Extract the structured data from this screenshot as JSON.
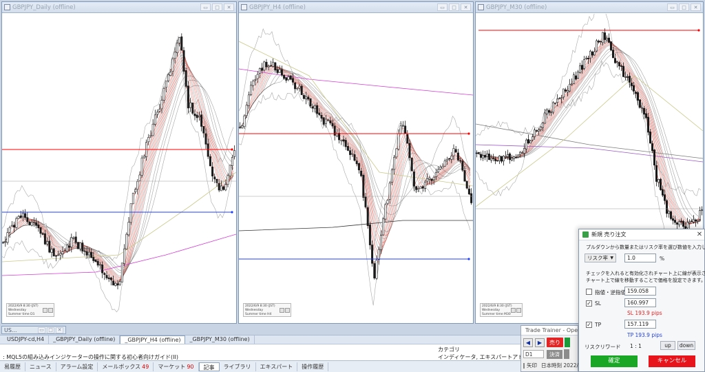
{
  "colors": {
    "candle": "#1a1a1a",
    "sl_line": "#ff0000",
    "tp_line": "#1f3fff",
    "ribbon_red": "#e8483a",
    "ribbon_gray": "#555555",
    "sell": "#e22424",
    "buy": "#1c9a3a"
  },
  "charts": [
    {
      "title": "GBPJPY_Daily (offline)",
      "info": {
        "line1": "2022/6/9 8:30 (JST)",
        "line2": "Wednesday",
        "line3": "Summer time",
        "tf": "D1"
      }
    },
    {
      "title": "GBPJPY_H4 (offline)",
      "info": {
        "line1": "2022/6/9 8:30 (JST)",
        "line2": "Wednesday",
        "line3": "Summer time",
        "tf": "H4"
      }
    },
    {
      "title": "GBPJPY_M30 (offline)",
      "info": {
        "line1": "2022/6/9 8:30 (JST)",
        "line2": "Wednesday",
        "line3": "Summer time",
        "tf": "M30"
      }
    }
  ],
  "minimized_window": {
    "title": "US..."
  },
  "chart_tabs": [
    "USDJPY-cd,H4",
    "_GBPJPY_Daily (offline)",
    "_GBPJPY_H4 (offline)",
    "_GBPJPY_M30 (offline)"
  ],
  "active_chart_tab": 2,
  "navigator": {
    "left_text": ": MQL5の組み込みインジケーターの操作に関する初心者向けガイド(II)",
    "category_header": "カテゴリ",
    "category_value": "インディケータ, エキスパートアドバイザー, インディ"
  },
  "terminal_tabs": [
    {
      "label": "易履歴"
    },
    {
      "label": "ニュース"
    },
    {
      "label": "アラーム設定"
    },
    {
      "label": "メールボックス",
      "count": "49"
    },
    {
      "label": "マーケット",
      "count": "90"
    },
    {
      "label": "記事",
      "active": true
    },
    {
      "label": "ライブラリ"
    },
    {
      "label": "エキスパート"
    },
    {
      "label": "操作履歴"
    }
  ],
  "trade_trainer": {
    "title": "Trade Trainer - Operat",
    "sell_label": "売り",
    "timeframe": "D1",
    "settle_label": "決済",
    "arrow_label": "矢印",
    "time_label": "日本時刻 2022/"
  },
  "order_dialog": {
    "title": "新規 売り注文",
    "instruction": "プルダウンから数量またはリスク率を選び数値を入力してください。",
    "mode_select": "リスク率",
    "risk_value": "1.0",
    "risk_unit": "%",
    "help_line1": "チェックを入れると有効化されチャート上に線が表示されます。",
    "help_line2": "チャート上で線を移動することで価格を設定できます。",
    "limit_label": "指値・逆指値",
    "limit_value": "159.058",
    "limit_checked": false,
    "sl_label": "SL",
    "sl_value": "160.997",
    "sl_checked": true,
    "sl_pips": "SL 193.9 pips",
    "tp_label": "TP",
    "tp_value": "157.119",
    "tp_checked": true,
    "tp_pips": "TP 193.9 pips",
    "rr_label": "リスクリワード",
    "rr_value": "1 : 1",
    "up_label": "up",
    "down_label": "down",
    "ok_label": "確定",
    "cancel_label": "キャンセル"
  }
}
